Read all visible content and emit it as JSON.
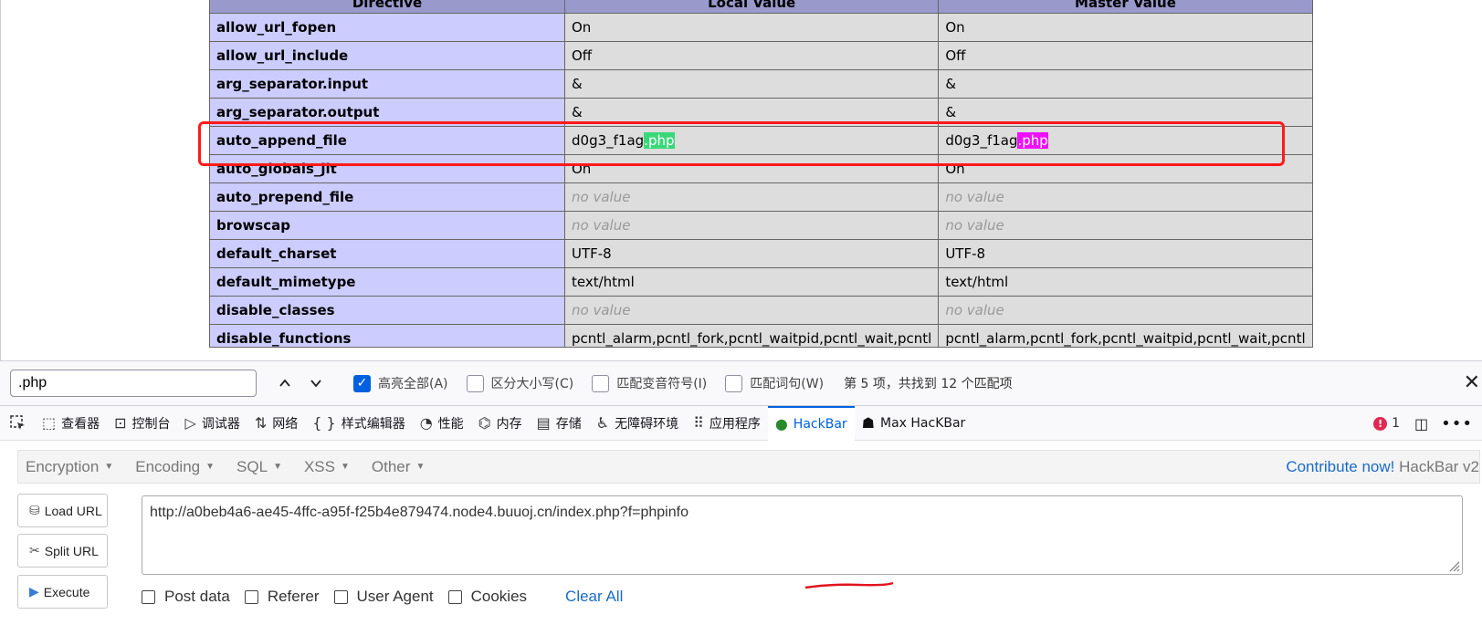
{
  "table": {
    "headers": [
      "Directive",
      "Local Value",
      "Master Value"
    ],
    "rows": [
      {
        "directive": "allow_url_fopen",
        "local": "On",
        "master": "On"
      },
      {
        "directive": "allow_url_include",
        "local": "Off",
        "master": "Off"
      },
      {
        "directive": "arg_separator.input",
        "local": "&",
        "master": "&"
      },
      {
        "directive": "arg_separator.output",
        "local": "&",
        "master": "&"
      },
      {
        "directive": "auto_append_file",
        "local_prefix": "d0g3_f1ag",
        "local_hl": ".php",
        "master_prefix": "d0g3_f1ag",
        "master_hl": ".php"
      },
      {
        "directive": "auto_globals_jit",
        "local": "On",
        "master": "On"
      },
      {
        "directive": "auto_prepend_file",
        "local": "no value",
        "master": "no value"
      },
      {
        "directive": "browscap",
        "local": "no value",
        "master": "no value"
      },
      {
        "directive": "default_charset",
        "local": "UTF-8",
        "master": "UTF-8"
      },
      {
        "directive": "default_mimetype",
        "local": "text/html",
        "master": "text/html"
      },
      {
        "directive": "disable_classes",
        "local": "no value",
        "master": "no value"
      },
      {
        "directive": "disable_functions",
        "local": "pcntl_alarm,pcntl_fork,pcntl_waitpid,pcntl_wait,pcntl",
        "master": "pcntl_alarm,pcntl_fork,pcntl_waitpid,pcntl_wait,pcntl"
      }
    ]
  },
  "find_bar": {
    "query": ".php",
    "highlight_all": "高亮全部(A)",
    "match_case": "区分大小写(C)",
    "match_diacritics": "匹配变音符号(I)",
    "whole_words": "匹配词句(W)",
    "status": "第 5 项，共找到 12 个匹配项"
  },
  "devtools": {
    "tabs": [
      "查看器",
      "控制台",
      "调试器",
      "网络",
      "样式编辑器",
      "性能",
      "内存",
      "存储",
      "无障碍环境",
      "应用程序",
      "HackBar",
      "Max HacKBar"
    ],
    "error_count": "1"
  },
  "hackbar": {
    "menu": [
      "Encryption",
      "Encoding",
      "SQL",
      "XSS",
      "Other"
    ],
    "contribute_link": "Contribute now!",
    "contribute_name": "HackBar v2",
    "load_url": "Load URL",
    "split_url": "Split URL",
    "execute": "Execute",
    "url": "http://a0beb4a6-ae45-4ffc-a95f-f25b4e879474.node4.buuoj.cn/index.php?f=phpinfo",
    "options": [
      "Post data",
      "Referer",
      "User Agent",
      "Cookies"
    ],
    "clear_all": "Clear All"
  },
  "colors": {
    "table_header": "#9999cc",
    "directive_cell": "#ccccff",
    "value_cell": "#dddddd",
    "highlight_current": "#38d878",
    "highlight_other": "#ef0fff",
    "annotation_red": "#ff1a1a",
    "accent_blue": "#0061e0"
  }
}
